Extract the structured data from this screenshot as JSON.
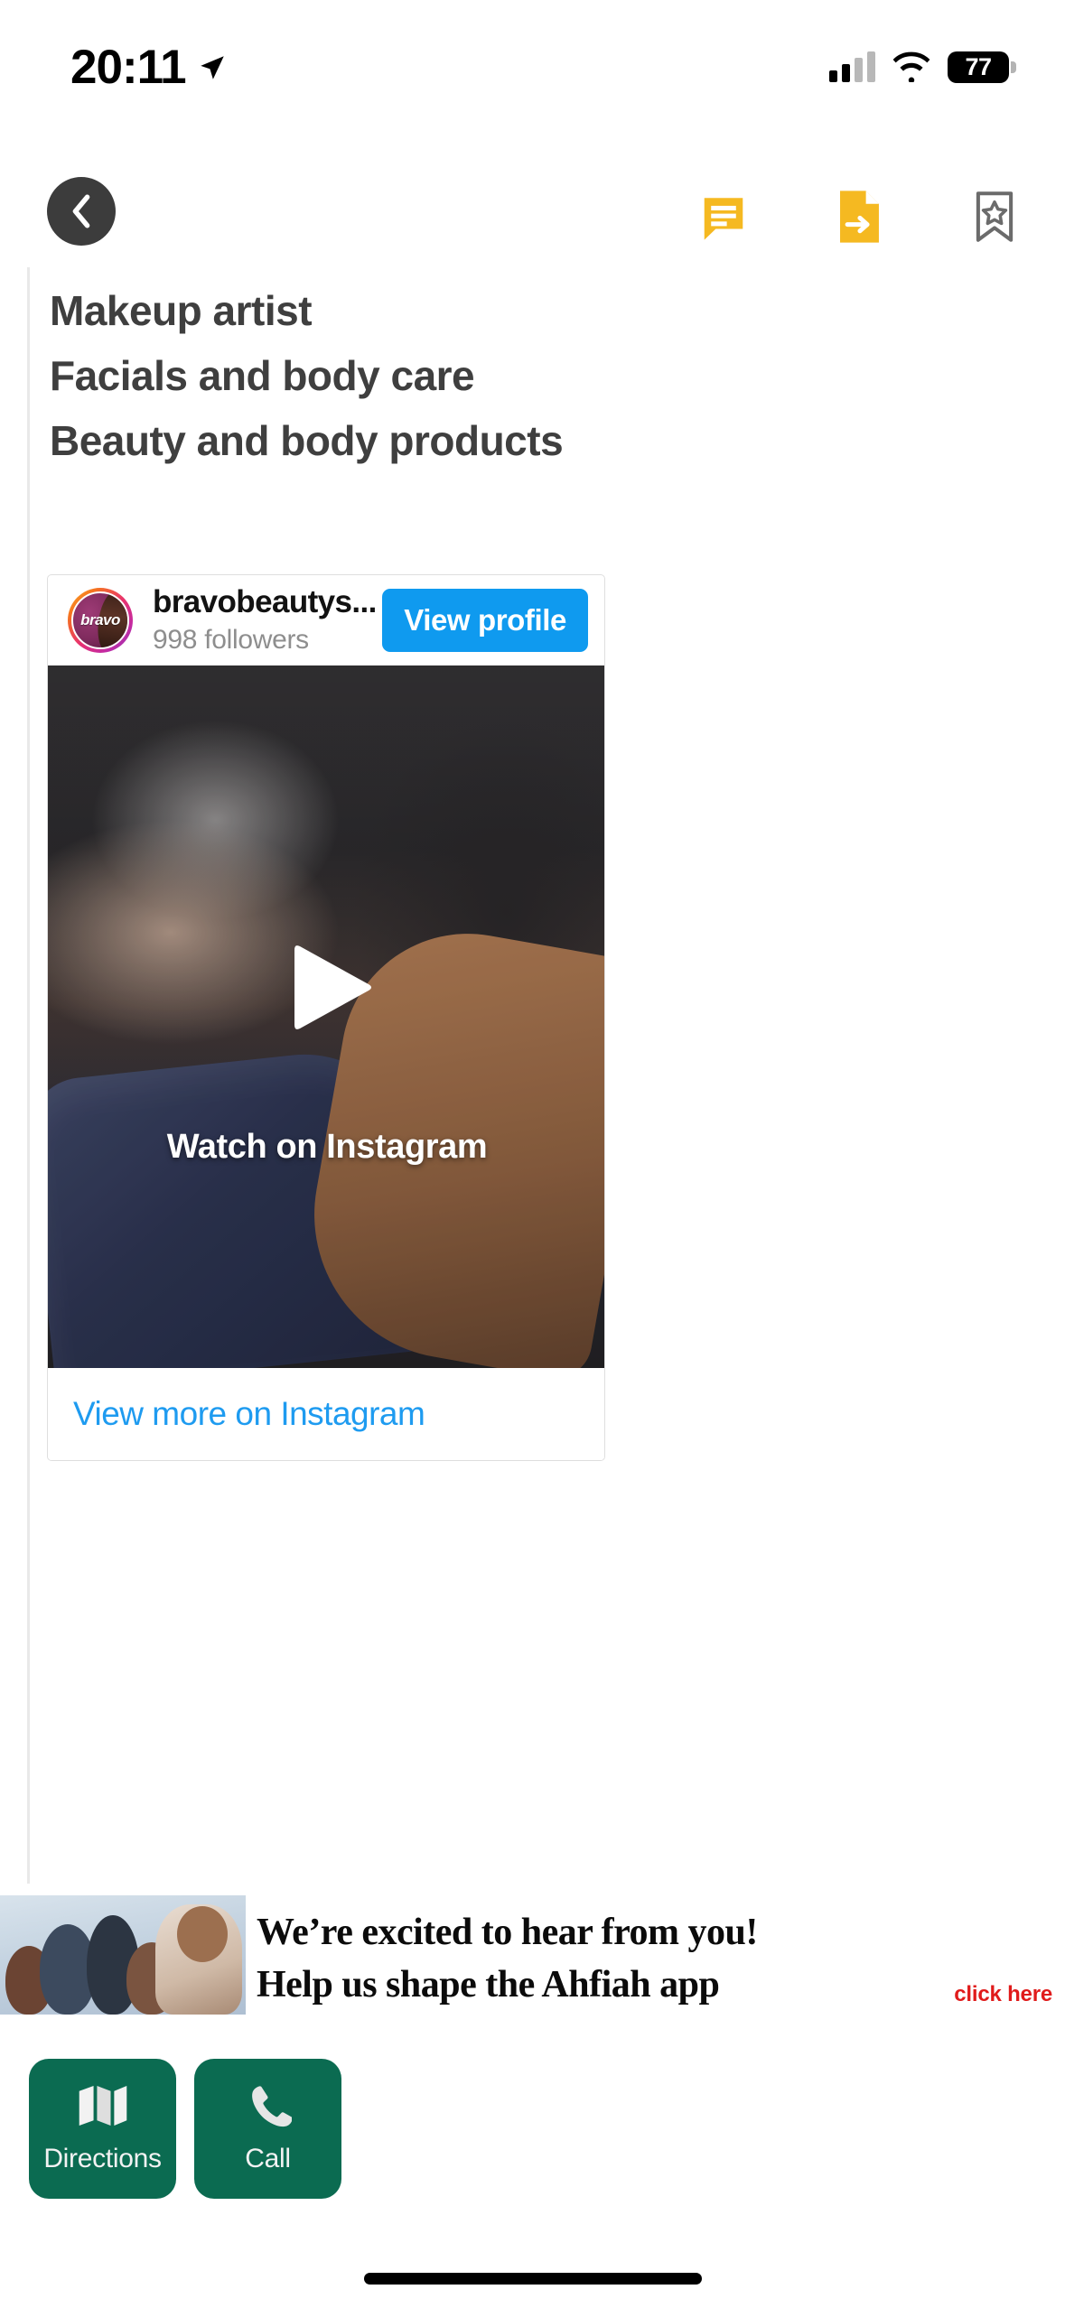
{
  "status_bar": {
    "time": "20:11",
    "battery_percent": "77",
    "icons": [
      "location-arrow-icon",
      "cellular-signal-icon",
      "wifi-icon",
      "battery-icon"
    ]
  },
  "toolbar": {
    "back_label": "Back",
    "icons": [
      {
        "name": "chat-bubble-icon",
        "color": "#f5b921"
      },
      {
        "name": "document-share-icon",
        "color": "#f5b921"
      },
      {
        "name": "bookmark-star-icon",
        "color": "#6b6b6b"
      }
    ]
  },
  "listing": {
    "description_lines": [
      "Makeup artist",
      "Facials and body care",
      "Beauty and body products"
    ]
  },
  "instagram_embed": {
    "username": "bravobeautys...",
    "followers": "998 followers",
    "avatar_logo_text": "bravo",
    "view_profile_label": "View profile",
    "watch_overlay_label": "Watch on Instagram",
    "view_more_label": "View more on Instagram",
    "accent_color": "#0f9aef"
  },
  "ad_banner": {
    "line1": "We’re excited to hear from you!",
    "line2": "Help us shape the Ahfiah app",
    "cta": "click here",
    "cta_color": "#e01b1b"
  },
  "action_bar": {
    "buttons": [
      {
        "label": "Directions",
        "icon": "map-icon"
      },
      {
        "label": "Call",
        "icon": "phone-icon"
      }
    ],
    "color": "#0b6b51"
  }
}
